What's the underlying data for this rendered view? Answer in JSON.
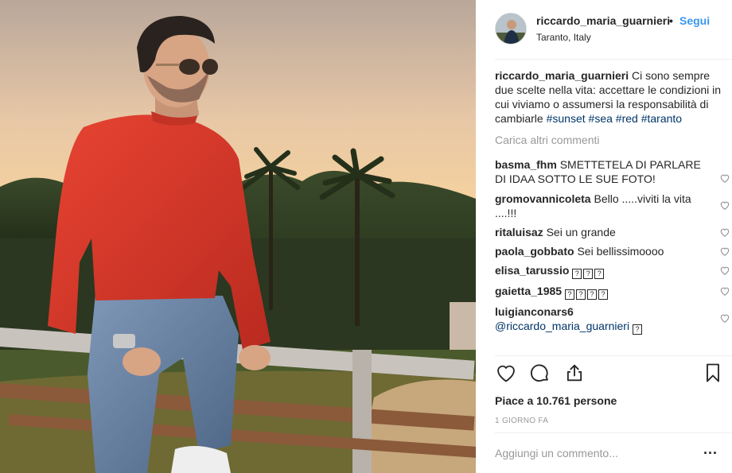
{
  "post": {
    "username": "riccardo_maria_guarnieri",
    "separator_dot": "•",
    "follow_label": "Segui",
    "location": "Taranto, Italy",
    "caption_username": "riccardo_maria_guarnieri",
    "caption_text": "Ci sono sempre due scelte nella vita: accettare le condizioni in cui viviamo o assumersi la responsabilità di cambiarle",
    "hashtags": [
      "#sunset",
      "#sea",
      "#red",
      "#taranto"
    ],
    "load_more_label": "Carica altri commenti",
    "likes_text": "Piace a 10.761 persone",
    "time_label": "1 GIORNO FA",
    "add_comment_placeholder": "Aggiungi un commento...",
    "more_label": "..."
  },
  "comments": [
    {
      "user": "basma_fhm",
      "text": "SMETTETELA DI PARLARE DI IDAA SOTTO LE SUE FOTO!"
    },
    {
      "user": "gromovannicoleta",
      "text": "Bello .....viviti la vita ....!!!"
    },
    {
      "user": "ritaluisaz",
      "text": "Sei un grande"
    },
    {
      "user": "paola_gobbato",
      "text": "Sei bellissimoooo"
    },
    {
      "user": "elisa_tarussio",
      "text": "",
      "emoji_count": 3,
      "emoji_glyph": "?"
    },
    {
      "user": "gaietta_1985",
      "text": "",
      "emoji_count": 4,
      "emoji_glyph": "?"
    },
    {
      "user": "luigianconars6",
      "text": "@riccardo_maria_guarnieri",
      "emoji_count": 1,
      "emoji_glyph": "?"
    }
  ],
  "icons": {
    "like": "heart-icon",
    "comment": "comment-bubble-icon",
    "share": "share-icon",
    "save": "bookmark-icon",
    "comment_like": "heart-icon"
  },
  "colors": {
    "link_blue": "#3897f0",
    "hashtag": "#003569",
    "muted": "#999999",
    "text": "#262626",
    "sweater_red": "#d8342a"
  }
}
